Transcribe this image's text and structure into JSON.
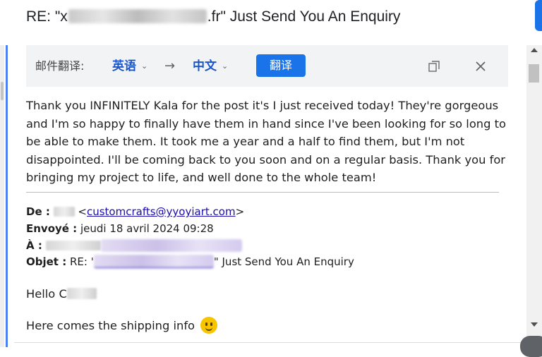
{
  "email": {
    "subject_prefix": "RE: \"x",
    "subject_suffix": ".fr\" Just Send You An Enquiry"
  },
  "translator": {
    "label": "邮件翻译:",
    "source_lang": "英语",
    "target_lang": "中文",
    "arrow": "→",
    "translate_button": "翻译",
    "chevron": "⌄"
  },
  "body": {
    "paragraph": "Thank you INFINITELY Kala for the post it's I just received today! They're gorgeous and I'm so happy to finally have them in hand since I've been looking for so long to be able to make them. It took me a year and a half to find them, but I'm not disappointed. I'll be coming back to you soon and on a regular basis. Thank you for bringing my project to life, and well done to the whole team!"
  },
  "quoted": {
    "from_label": "De :",
    "from_email": "customcrafts@yyoyiart.com",
    "sent_label": "Envoyé :",
    "sent_value": "jeudi 18 avril 2024 09:28",
    "to_label": "À :",
    "subject_label": "Objet :",
    "subject_prefix": "RE: '",
    "subject_suffix": "\" Just Send You An Enquiry"
  },
  "greeting": "Hello C",
  "shipping_text": "Here comes the shipping info",
  "colors": {
    "accent": "#1a73e8",
    "lang": "#1a56c8",
    "link": "#1a0dab",
    "blur_purple": "#cbc0e8"
  },
  "icons": [
    "copy-icon",
    "close-icon",
    "chevron-down-icon",
    "arrow-right-icon",
    "smiley-emoji-icon"
  ]
}
